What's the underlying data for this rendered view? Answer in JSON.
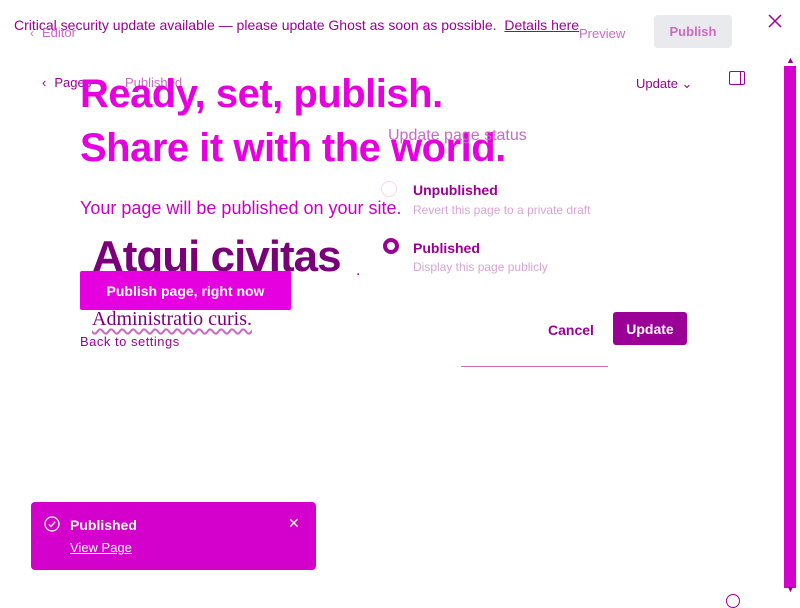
{
  "banner": {
    "text": "Critical security update available — please update Ghost as soon as possible.",
    "link": "Details here"
  },
  "editor": {
    "back_label": "Editor",
    "preview_label": "Preview",
    "publish_label": "Publish"
  },
  "settings_header": {
    "back_label": "Pages",
    "status": "Published",
    "update_label": "Update"
  },
  "page": {
    "title": "Atqui civitas",
    "body": "Administratio curis."
  },
  "publish_flow": {
    "headline_line1": "Ready, set, publish.",
    "headline_line2": "Share it with the world.",
    "subline": "Your page will be published on your site.",
    "publish_now_label": "Publish page, right now",
    "back_to_settings": "Back to settings"
  },
  "status_menu": {
    "title": "Update page status",
    "options": [
      {
        "label": "Unpublished",
        "description": "Revert this page to a private draft",
        "selected": false
      },
      {
        "label": "Published",
        "description": "Display this page publicly",
        "selected": true
      }
    ],
    "cancel_label": "Cancel",
    "update_label": "Update"
  },
  "toast": {
    "title": "Published",
    "link": "View Page"
  },
  "colors": {
    "accent": "#e600e0",
    "dark_accent": "#9b0096",
    "toast_bg": "#d400cc",
    "light_button": "#e8eaed"
  }
}
